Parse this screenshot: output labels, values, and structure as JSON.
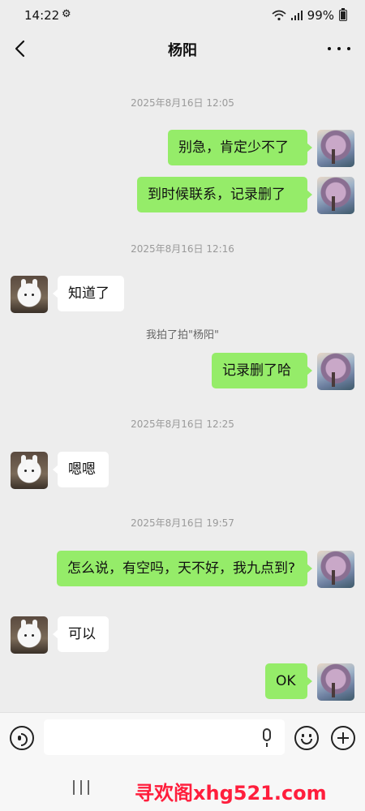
{
  "status_bar": {
    "time": "14:22",
    "battery": "99%"
  },
  "header": {
    "title": "杨阳"
  },
  "messages": {
    "ts1": "2025年8月16日 12:05",
    "m1": "别急，肯定少不了",
    "m2": "到时候联系，记录删了",
    "ts2": "2025年8月16日 12:16",
    "m3": "知道了",
    "system1": "我拍了拍\"杨阳\"",
    "m4": "记录删了哈",
    "ts3": "2025年8月16日 12:25",
    "m5": "嗯嗯",
    "ts4": "2025年8月16日 19:57",
    "m6": "怎么说，有空吗，天不好，我九点到?",
    "m7": "可以",
    "m8": "OK"
  },
  "input_bar": {
    "value": ""
  },
  "watermark": "寻欢阁xhg521.com"
}
